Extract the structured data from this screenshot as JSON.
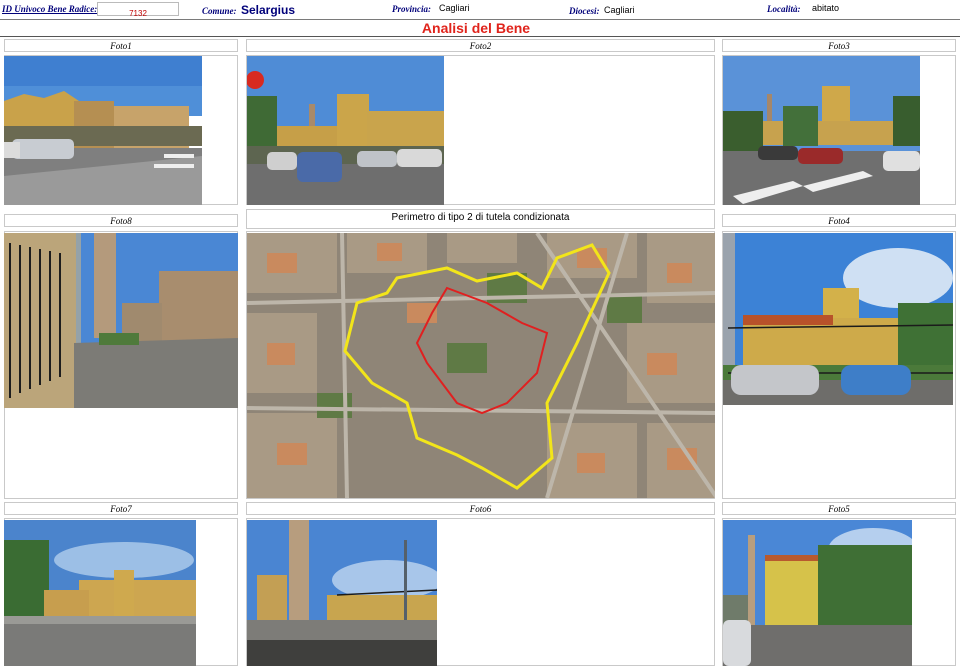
{
  "header": {
    "id_label": "ID Univoco Bene Radice:",
    "id_value": "7132",
    "comune_label": "Comune:",
    "comune_value": "Selargius",
    "provincia_label": "Provincia:",
    "provincia_value": "Cagliari",
    "diocesi_label": "Diocesi:",
    "diocesi_value": "Cagliari",
    "localita_label": "Località:",
    "localita_value": "abitato"
  },
  "title": "Analisi del Bene",
  "photo_labels": {
    "foto1": "Foto1",
    "foto2": "Foto2",
    "foto3": "Foto3",
    "foto8": "Foto8",
    "foto4": "Foto4",
    "foto7": "Foto7",
    "foto6": "Foto6",
    "foto5": "Foto5"
  },
  "map_caption": "Perimetro di tipo 2 di tutela condizionata",
  "colors": {
    "label_blue": "#00007a",
    "title_red": "#e0241c",
    "perimeter_yellow": "#f2e51a",
    "perimeter_red": "#e02020",
    "border_gray": "#c9c9c9"
  }
}
